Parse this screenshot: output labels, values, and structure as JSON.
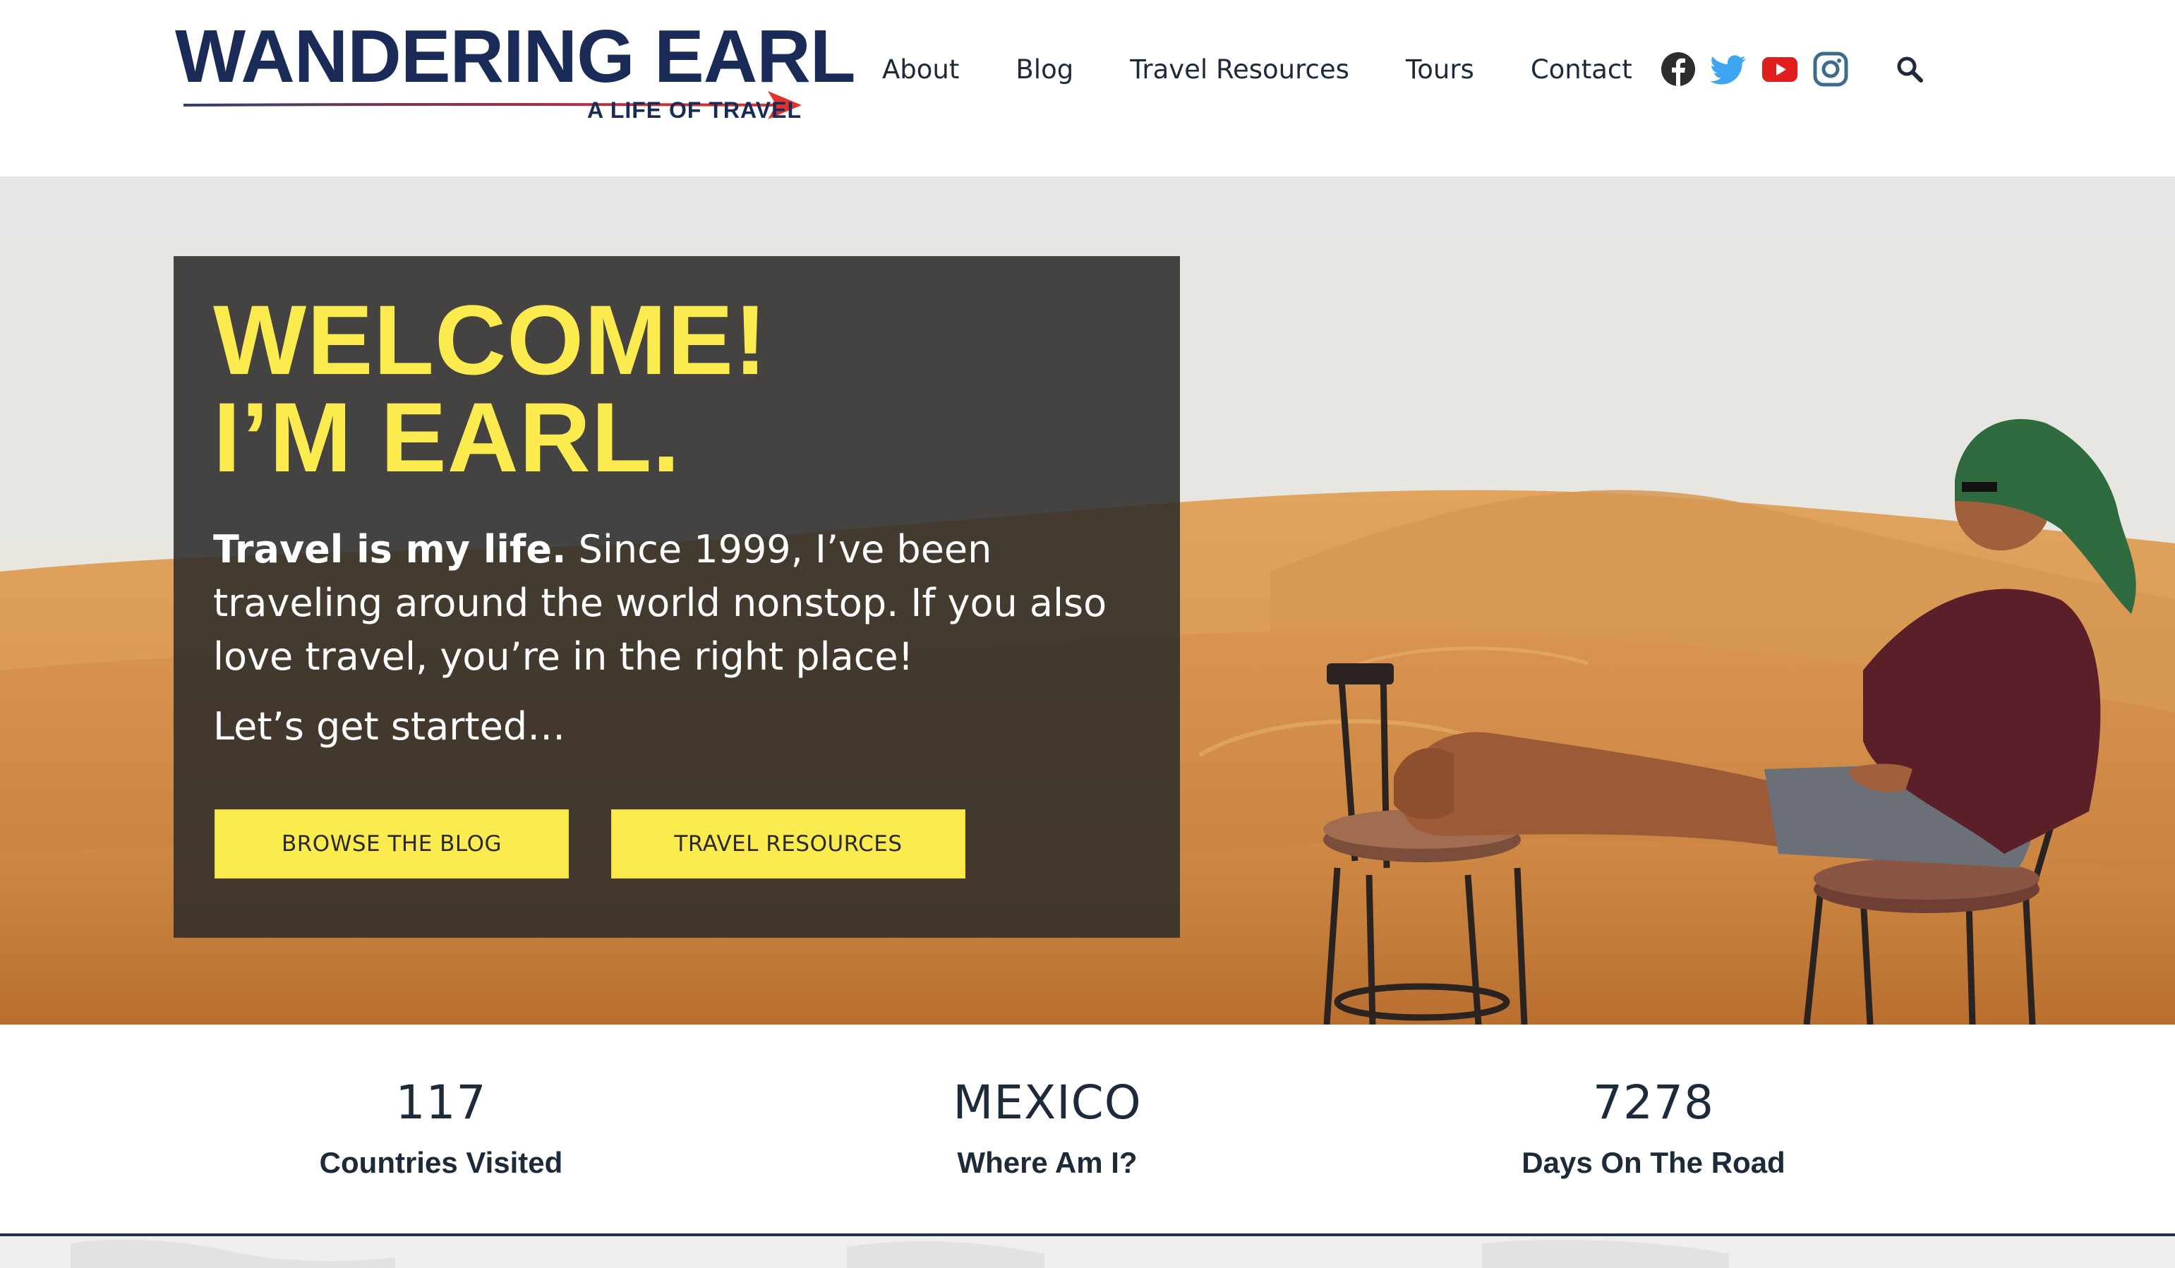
{
  "header": {
    "logo": {
      "title": "WANDERING EARL",
      "subtitle": "A LIFE OF TRAVEL"
    },
    "nav": [
      {
        "label": "About"
      },
      {
        "label": "Blog"
      },
      {
        "label": "Travel Resources"
      },
      {
        "label": "Tours"
      },
      {
        "label": "Contact"
      }
    ],
    "social": [
      {
        "icon": "facebook-icon",
        "color": "#2d2d2d"
      },
      {
        "icon": "twitter-icon",
        "color": "#3ea6f1"
      },
      {
        "icon": "youtube-icon",
        "color": "#e11d1d"
      },
      {
        "icon": "instagram-icon",
        "color": "#3d6b8e"
      }
    ],
    "search_icon": "search-icon"
  },
  "hero": {
    "headline_line1": "WELCOME!",
    "headline_line2": "I’M EARL.",
    "intro_bold": "Travel is my life.",
    "intro_text": " Since 1999, I’ve been traveling around the world nonstop. If you also love travel, you’re in the right place!",
    "cta_text": "Let’s get started…",
    "buttons": {
      "blog": "BROWSE THE BLOG",
      "resources": "TRAVEL RESOURCES"
    }
  },
  "stats": [
    {
      "value": "117",
      "label": "Countries Visited"
    },
    {
      "value": "MEXICO",
      "label": "Where Am I?"
    },
    {
      "value": "7278",
      "label": "Days On The Road"
    }
  ],
  "colors": {
    "accent_yellow": "#fbeb4f",
    "brand_navy": "#1b2b57",
    "logo_arrow_red": "#e0332b",
    "panel_dark": "#2e2c2a",
    "text_dark": "#1d2a3a"
  }
}
